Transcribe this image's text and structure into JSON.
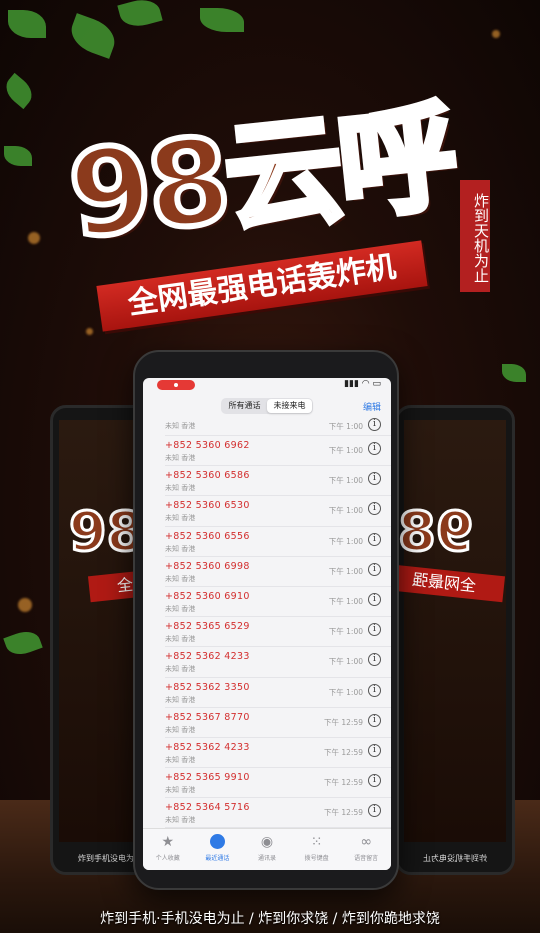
{
  "poster": {
    "title": "98云呼",
    "subtitle_banner": "全网最强电话轰炸机",
    "vertical_tag": "炸到天机为止",
    "bottom_caption": "炸到手机·手机没电为止 / 炸到你求饶 / 炸到你跪地求饶",
    "side_title": "98",
    "side_banner": "全网最强",
    "side_caption": "炸到手机没电为止"
  },
  "phone": {
    "segmented": {
      "all": "所有通话",
      "missed": "未接来电"
    },
    "edit_label": "编辑",
    "first_row": {
      "sub": "未知 香港",
      "time": "下午 1:00"
    },
    "calls": [
      {
        "number": "+852 5360 6962",
        "sub": "未知 香港",
        "time": "下午 1:00"
      },
      {
        "number": "+852 5360 6586",
        "sub": "未知 香港",
        "time": "下午 1:00"
      },
      {
        "number": "+852 5360 6530",
        "sub": "未知 香港",
        "time": "下午 1:00"
      },
      {
        "number": "+852 5360 6556",
        "sub": "未知 香港",
        "time": "下午 1:00"
      },
      {
        "number": "+852 5360 6998",
        "sub": "未知 香港",
        "time": "下午 1:00"
      },
      {
        "number": "+852 5360 6910",
        "sub": "未知 香港",
        "time": "下午 1:00"
      },
      {
        "number": "+852 5365 6529",
        "sub": "未知 香港",
        "time": "下午 1:00"
      },
      {
        "number": "+852 5362 4233",
        "sub": "未知 香港",
        "time": "下午 1:00"
      },
      {
        "number": "+852 5362 3350",
        "sub": "未知 香港",
        "time": "下午 1:00"
      },
      {
        "number": "+852 5367 8770",
        "sub": "未知 香港",
        "time": "下午 12:59"
      },
      {
        "number": "+852 5362 4233",
        "sub": "未知 香港",
        "time": "下午 12:59"
      },
      {
        "number": "+852 5365 9910",
        "sub": "未知 香港",
        "time": "下午 12:59"
      },
      {
        "number": "+852 5364 5716",
        "sub": "未知 香港",
        "time": "下午 12:59"
      }
    ],
    "tabs": [
      {
        "label": "个人收藏",
        "icon": "star-icon"
      },
      {
        "label": "最近通话",
        "icon": "clock-icon"
      },
      {
        "label": "通讯录",
        "icon": "contact-icon"
      },
      {
        "label": "拨号键盘",
        "icon": "keypad-icon"
      },
      {
        "label": "语音留言",
        "icon": "voicemail-icon"
      }
    ],
    "accent_color": "#2f7ae5",
    "missed_color": "#d32f2f"
  }
}
